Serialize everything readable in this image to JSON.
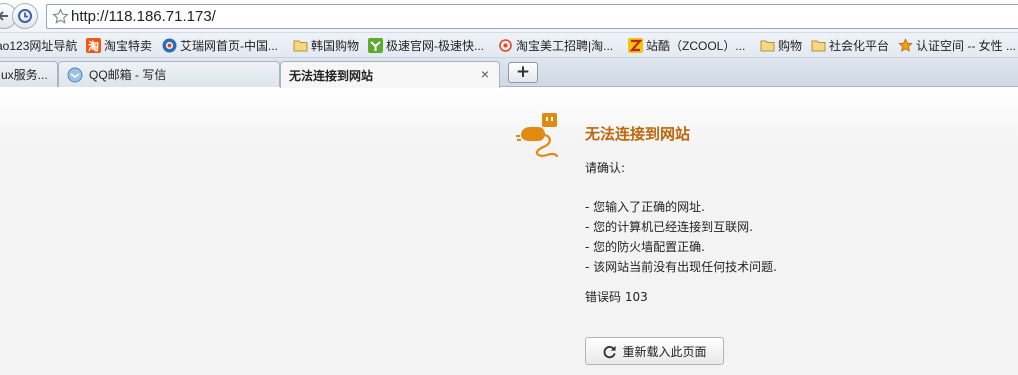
{
  "address_bar": {
    "url": "http://118.186.71.173/"
  },
  "bookmarks": [
    {
      "label": "ao123网址导航",
      "icon": "none"
    },
    {
      "label": "淘宝特卖",
      "icon": "taobao-icon"
    },
    {
      "label": "艾瑞网首页-中国...",
      "icon": "iresearch-icon"
    },
    {
      "label": "韩国购物",
      "icon": "folder-icon"
    },
    {
      "label": "极速官网-极速快...",
      "icon": "jisu-icon"
    },
    {
      "label": "淘宝美工招聘|淘...",
      "icon": "target-icon"
    },
    {
      "label": "站酷（ZCOOL）...",
      "icon": "zcool-icon"
    },
    {
      "label": "购物",
      "icon": "folder-icon"
    },
    {
      "label": "社会化平台",
      "icon": "folder-icon"
    },
    {
      "label": "认证空间 -- 女性 ...",
      "icon": "star-icon"
    }
  ],
  "tabs": [
    {
      "label": "ux服务...",
      "active": false
    },
    {
      "label": "QQ邮箱 - 写信",
      "active": false
    },
    {
      "label": "无法连接到网站",
      "active": true
    }
  ],
  "new_tab_label": "+",
  "error": {
    "title": "无法连接到网站",
    "confirm_label": "请确认:",
    "checks": [
      "- 您输入了正确的网址.",
      "- 您的计算机已经连接到互联网.",
      "- 您的防火墙配置正确.",
      "- 该网站当前没有出现任何技术问题."
    ],
    "code": "错误码 103",
    "reload_label": "重新载入此页面"
  },
  "colors": {
    "title": "#c0650a",
    "icon": "#e08a12"
  }
}
